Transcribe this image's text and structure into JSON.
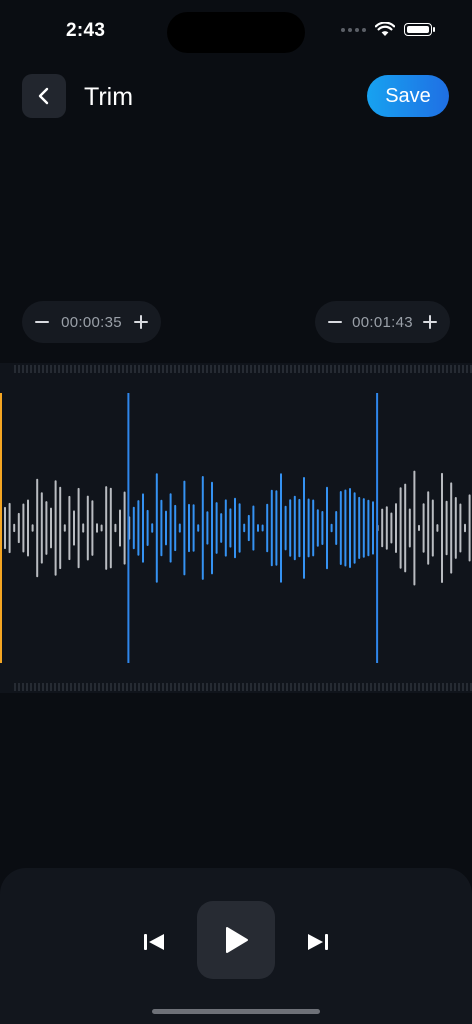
{
  "status_bar": {
    "time": "2:43",
    "icons": [
      "signal-dots-icon",
      "wifi-icon",
      "battery-icon"
    ]
  },
  "header": {
    "back_icon": "chevron-left-icon",
    "title": "Trim",
    "save_label": "Save"
  },
  "trim": {
    "start_time": "00:00:35",
    "end_time": "00:01:43"
  },
  "waveform": {
    "playhead_color": "#f5a623",
    "selection_color": "#3592f2",
    "unselected_color": "#b9bcc1",
    "handle_color": "#2f86ea",
    "selection_start_fraction": 0.272,
    "selection_end_fraction": 0.799
  },
  "player": {
    "controls": [
      "skip-back-icon",
      "play-icon",
      "skip-forward-icon"
    ]
  },
  "colors": {
    "background": "#0a0d12",
    "accent_gradient": [
      "#17a2f0",
      "#1f6fe4"
    ]
  }
}
